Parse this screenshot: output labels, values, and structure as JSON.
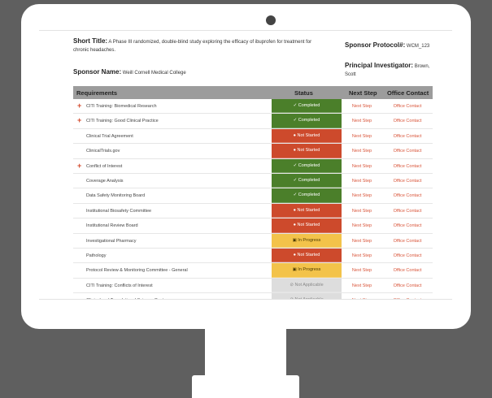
{
  "info": {
    "short_title_label": "Short Title:",
    "short_title_value": "A Phase III randomized, double-blind study exploring the efficacy of ibuprofen for treatment for chronic headaches.",
    "sponsor_name_label": "Sponsor Name:",
    "sponsor_name_value": "Weill Cornell Medical College",
    "sponsor_protocol_label": "Sponsor Protocol#:",
    "sponsor_protocol_value": "WCM_123",
    "pi_label": "Principal Investigator:",
    "pi_value": "Brown, Scott"
  },
  "table": {
    "headers": {
      "requirements": "Requirements",
      "status": "Status",
      "next_step": "Next Step",
      "office_contact": "Office Contact"
    },
    "rows": [
      {
        "expand": "+",
        "requirement": "CITI Training: Biomedical Research",
        "status": "✓ Completed",
        "status_kind": "completed",
        "next": "Next Step",
        "office": "Office Contact"
      },
      {
        "expand": "+",
        "requirement": "CITI Training: Good Clinical Practice",
        "status": "✓ Completed",
        "status_kind": "completed",
        "next": "Next Step",
        "office": "Office Contact"
      },
      {
        "expand": "",
        "requirement": "Clinical Trial Agreement",
        "status": "● Not Started",
        "status_kind": "notstarted",
        "next": "Next Step",
        "office": "Office Contact"
      },
      {
        "expand": "",
        "requirement": "ClinicalTrials.gov",
        "status": "● Not Started",
        "status_kind": "notstarted",
        "next": "Next Step",
        "office": "Office Contact"
      },
      {
        "expand": "+",
        "requirement": "Conflict of Interest",
        "status": "✓ Completed",
        "status_kind": "completed",
        "next": "Next Step",
        "office": "Office Contact"
      },
      {
        "expand": "",
        "requirement": "Coverage Analysis",
        "status": "✓ Completed",
        "status_kind": "completed",
        "next": "Next Step",
        "office": "Office Contact"
      },
      {
        "expand": "",
        "requirement": "Data Safety Monitoring Board",
        "status": "✓ Completed",
        "status_kind": "completed",
        "next": "Next Step",
        "office": "Office Contact"
      },
      {
        "expand": "",
        "requirement": "Institutional Biosafety Committee",
        "status": "● Not Started",
        "status_kind": "notstarted",
        "next": "Next Step",
        "office": "Office Contact"
      },
      {
        "expand": "",
        "requirement": "Institutional Review Board",
        "status": "● Not Started",
        "status_kind": "notstarted",
        "next": "Next Step",
        "office": "Office Contact"
      },
      {
        "expand": "",
        "requirement": "Investigational Pharmacy",
        "status": "▣ In Progress",
        "status_kind": "progress",
        "next": "Next Step",
        "office": "Office Contact"
      },
      {
        "expand": "",
        "requirement": "Pathology",
        "status": "● Not Started",
        "status_kind": "notstarted",
        "next": "Next Step",
        "office": "Office Contact"
      },
      {
        "expand": "",
        "requirement": "Protocol Review & Monitoring Committee - General",
        "status": "▣ In Progress",
        "status_kind": "progress",
        "next": "Next Step",
        "office": "Office Contact"
      },
      {
        "expand": "",
        "requirement": "CITI Training: Conflicts of Interest",
        "status": "⊘ Not Applicable",
        "status_kind": "na",
        "next": "Next Step",
        "office": "Office Contact"
      },
      {
        "expand": "",
        "requirement": "Clinical and Translational Science Center",
        "status": "⊘ Not Applicable",
        "status_kind": "na",
        "next": "Next Step",
        "office": "Office Contact"
      }
    ]
  },
  "colors": {
    "completed": "#4b7f2a",
    "not_started": "#cd4a2c",
    "in_progress": "#f3c34a",
    "not_applicable": "#dddddd",
    "link": "#d9553a",
    "header_bg": "#9c9c9c",
    "frame": "#5f5f5f"
  }
}
